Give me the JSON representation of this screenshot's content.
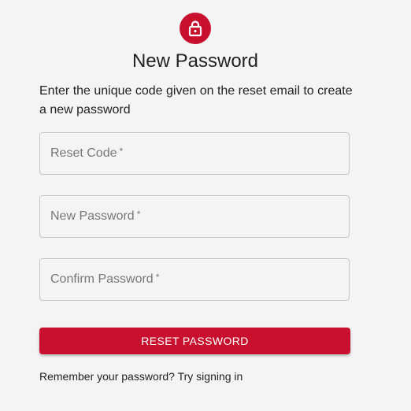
{
  "header": {
    "icon": "lock-icon",
    "title": "New Password",
    "instructions": "Enter the unique code given on the reset email to create a new password"
  },
  "form": {
    "fields": [
      {
        "label": "Reset Code",
        "required_marker": "*",
        "value": ""
      },
      {
        "label": "New Password",
        "required_marker": "*",
        "value": ""
      },
      {
        "label": "Confirm Password",
        "required_marker": "*",
        "value": ""
      }
    ],
    "submit_label": "RESET PASSWORD"
  },
  "footer": {
    "link_text": "Remember your password? Try signing in"
  },
  "colors": {
    "accent": "#c8102e",
    "background": "#f4f4f4",
    "field_border": "#c4c4c4",
    "label_text": "#777777"
  }
}
